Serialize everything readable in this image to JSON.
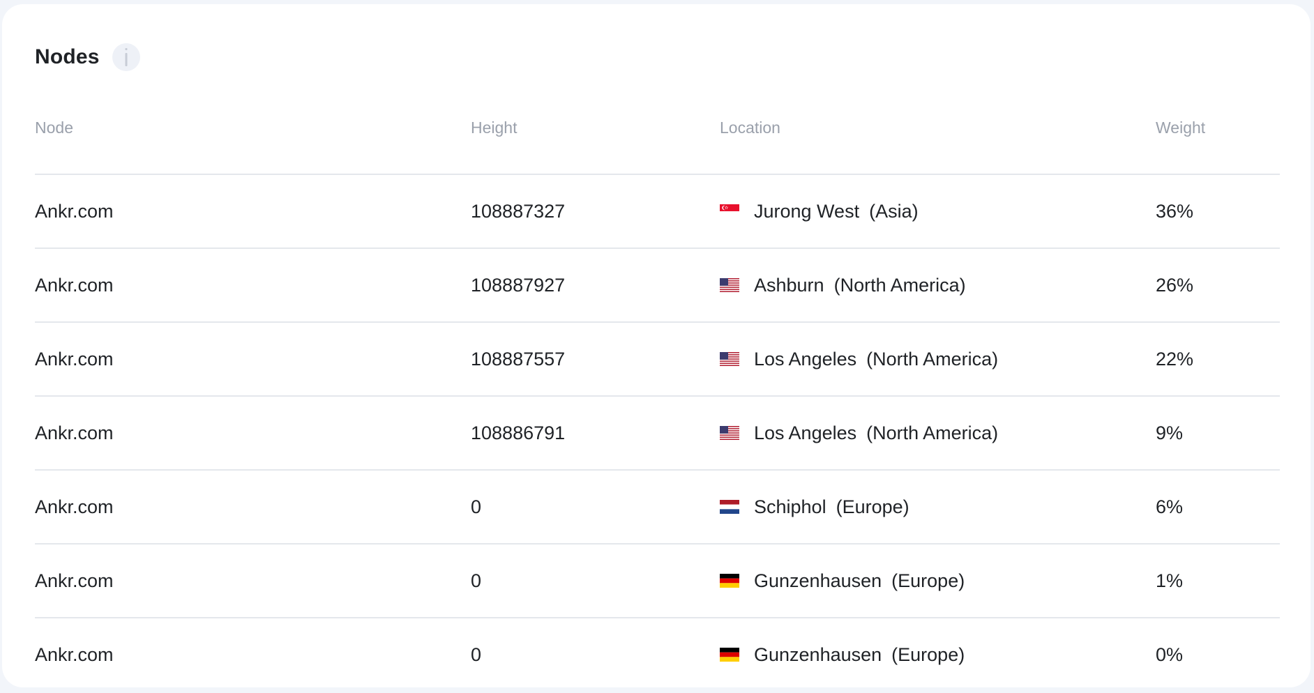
{
  "card": {
    "title": "Nodes",
    "info_icon": "info-icon"
  },
  "table": {
    "headers": {
      "node": "Node",
      "height": "Height",
      "location": "Location",
      "weight": "Weight"
    },
    "rows": [
      {
        "node": "Ankr.com",
        "height": "108887327",
        "flag": "singapore-flag-icon",
        "city": "Jurong West",
        "region": "(Asia)",
        "weight": "36%"
      },
      {
        "node": "Ankr.com",
        "height": "108887927",
        "flag": "usa-flag-icon",
        "city": "Ashburn",
        "region": "(North America)",
        "weight": "26%"
      },
      {
        "node": "Ankr.com",
        "height": "108887557",
        "flag": "usa-flag-icon",
        "city": "Los Angeles",
        "region": "(North America)",
        "weight": "22%"
      },
      {
        "node": "Ankr.com",
        "height": "108886791",
        "flag": "usa-flag-icon",
        "city": "Los Angeles",
        "region": "(North America)",
        "weight": "9%"
      },
      {
        "node": "Ankr.com",
        "height": "0",
        "flag": "netherlands-flag-icon",
        "city": "Schiphol",
        "region": "(Europe)",
        "weight": "6%"
      },
      {
        "node": "Ankr.com",
        "height": "0",
        "flag": "germany-flag-icon",
        "city": "Gunzenhausen",
        "region": "(Europe)",
        "weight": "1%"
      },
      {
        "node": "Ankr.com",
        "height": "0",
        "flag": "germany-flag-icon",
        "city": "Gunzenhausen",
        "region": "(Europe)",
        "weight": "0%"
      }
    ]
  },
  "colors": {
    "background": "#f2f5fa",
    "card": "#ffffff",
    "text": "#1f2226",
    "muted": "#9aa0ab",
    "divider": "#e4e7ec"
  }
}
